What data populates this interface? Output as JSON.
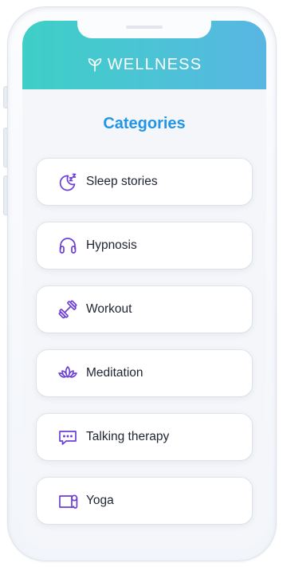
{
  "app": {
    "brand": "WELLNESS",
    "brand_icon": "sprout-icon"
  },
  "page": {
    "title": "Categories"
  },
  "categories": [
    {
      "label": "Sleep stories",
      "icon": "moon-sleep-icon"
    },
    {
      "label": "Hypnosis",
      "icon": "headphones-icon"
    },
    {
      "label": "Workout",
      "icon": "dumbbell-icon"
    },
    {
      "label": "Meditation",
      "icon": "lotus-icon"
    },
    {
      "label": "Talking therapy",
      "icon": "chat-bubble-icon"
    },
    {
      "label": "Yoga",
      "icon": "yoga-mat-icon"
    }
  ],
  "colors": {
    "header_gradient_start": "#3ecfc6",
    "header_gradient_end": "#58b6e2",
    "title": "#2196e6",
    "icon": "#6b3fd6",
    "label": "#1f2433",
    "screen_bg": "#f4f6f9"
  }
}
